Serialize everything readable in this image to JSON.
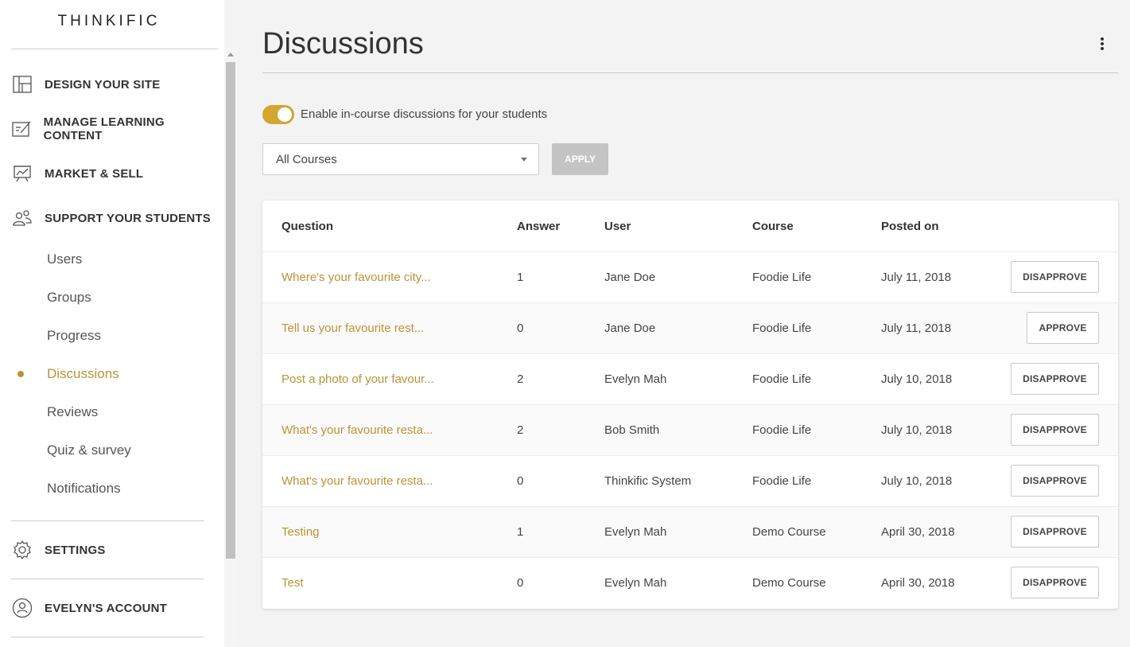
{
  "brand": {
    "logo_text": "THINKIFIC",
    "accent": "#bb9336",
    "toggle_color": "#d4a530"
  },
  "sidebar": {
    "sections": [
      {
        "label": "DESIGN YOUR SITE",
        "icon": "layout-icon"
      },
      {
        "label": "MANAGE LEARNING CONTENT",
        "icon": "edit-content-icon"
      },
      {
        "label": "MARKET & SELL",
        "icon": "presentation-chart-icon"
      },
      {
        "label": "SUPPORT YOUR STUDENTS",
        "icon": "people-icon"
      }
    ],
    "sub_items": [
      "Users",
      "Groups",
      "Progress",
      "Discussions",
      "Reviews",
      "Quiz & survey",
      "Notifications"
    ],
    "active_sub_item": "Discussions",
    "settings_label": "SETTINGS",
    "account_label": "EVELYN'S ACCOUNT"
  },
  "main": {
    "title": "Discussions",
    "toggle": {
      "label": "Enable in-course discussions for your students",
      "enabled": true
    },
    "filter": {
      "selected": "All Courses",
      "apply_label": "APPLY"
    },
    "table": {
      "headers": [
        "Question",
        "Answer",
        "User",
        "Course",
        "Posted on"
      ],
      "rows": [
        {
          "question": "Where's your favourite city...",
          "answer": "1",
          "user": "Jane Doe",
          "course": "Foodie Life",
          "posted": "July 11, 2018",
          "action": "DISAPPROVE"
        },
        {
          "question": "Tell us your favourite rest...",
          "answer": "0",
          "user": "Jane Doe",
          "course": "Foodie Life",
          "posted": "July 11, 2018",
          "action": "APPROVE"
        },
        {
          "question": "Post a photo of your favour...",
          "answer": "2",
          "user": "Evelyn Mah",
          "course": "Foodie Life",
          "posted": "July 10, 2018",
          "action": "DISAPPROVE"
        },
        {
          "question": "What's your favourite resta...",
          "answer": "2",
          "user": "Bob Smith",
          "course": "Foodie Life",
          "posted": "July 10, 2018",
          "action": "DISAPPROVE"
        },
        {
          "question": "What's your favourite resta...",
          "answer": "0",
          "user": "Thinkific System",
          "course": "Foodie Life",
          "posted": "July 10, 2018",
          "action": "DISAPPROVE"
        },
        {
          "question": "Testing",
          "answer": "1",
          "user": "Evelyn Mah",
          "course": "Demo Course",
          "posted": "April 30, 2018",
          "action": "DISAPPROVE"
        },
        {
          "question": "Test",
          "answer": "0",
          "user": "Evelyn Mah",
          "course": "Demo Course",
          "posted": "April 30, 2018",
          "action": "DISAPPROVE"
        }
      ]
    }
  }
}
